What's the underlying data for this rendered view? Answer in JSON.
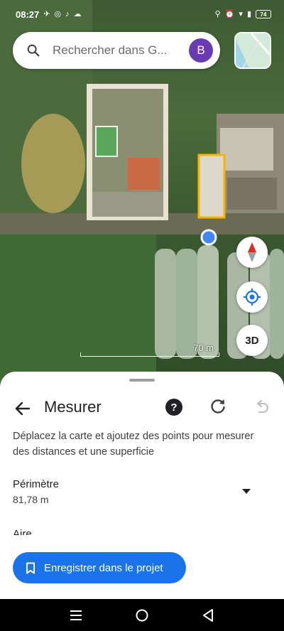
{
  "status_bar": {
    "time": "08:27",
    "battery": "74",
    "left_icons": [
      "airplane-icon",
      "instagram-icon",
      "tiktok-icon",
      "cloud-icon"
    ],
    "right_icons": [
      "location-icon",
      "alarm-icon",
      "wifi-icon",
      "signal-icon",
      "battery-icon"
    ]
  },
  "search": {
    "placeholder": "Rechercher dans G...",
    "avatar_letter": "B"
  },
  "map": {
    "scale_label": "70 m",
    "three_d_label": "3D"
  },
  "sheet": {
    "title": "Mesurer",
    "instructions": "Déplacez la carte et ajoutez des points pour mesurer des distances et une superficie",
    "perimeter_label": "Périmètre",
    "perimeter_value": "81,78 m",
    "area_label": "Aire",
    "save_button": "Enregistrer dans le projet"
  },
  "colors": {
    "accent": "#1a73e8",
    "avatar": "#6a3ab2",
    "measure_outline": "#f4b400"
  }
}
